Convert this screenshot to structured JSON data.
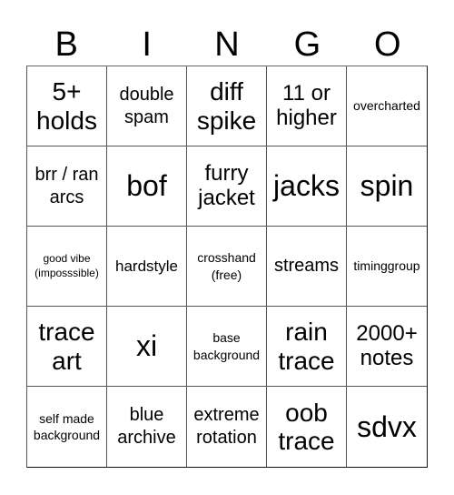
{
  "header": {
    "letters": [
      "B",
      "I",
      "N",
      "G",
      "O"
    ]
  },
  "cells": [
    "5+ holds",
    "double spam",
    "diff spike",
    "11 or higher",
    "overcharted",
    "brr / ran arcs",
    "bof",
    "furry jacket",
    "jacks",
    "spin",
    "good vibe (imposssible)",
    "hardstyle",
    "crosshand (free)",
    "streams",
    "timinggroup",
    "trace art",
    "xi",
    "base background",
    "rain trace",
    "2000+ notes",
    "self made background",
    "blue archive",
    "extreme rotation",
    "oob trace",
    "sdvx"
  ]
}
